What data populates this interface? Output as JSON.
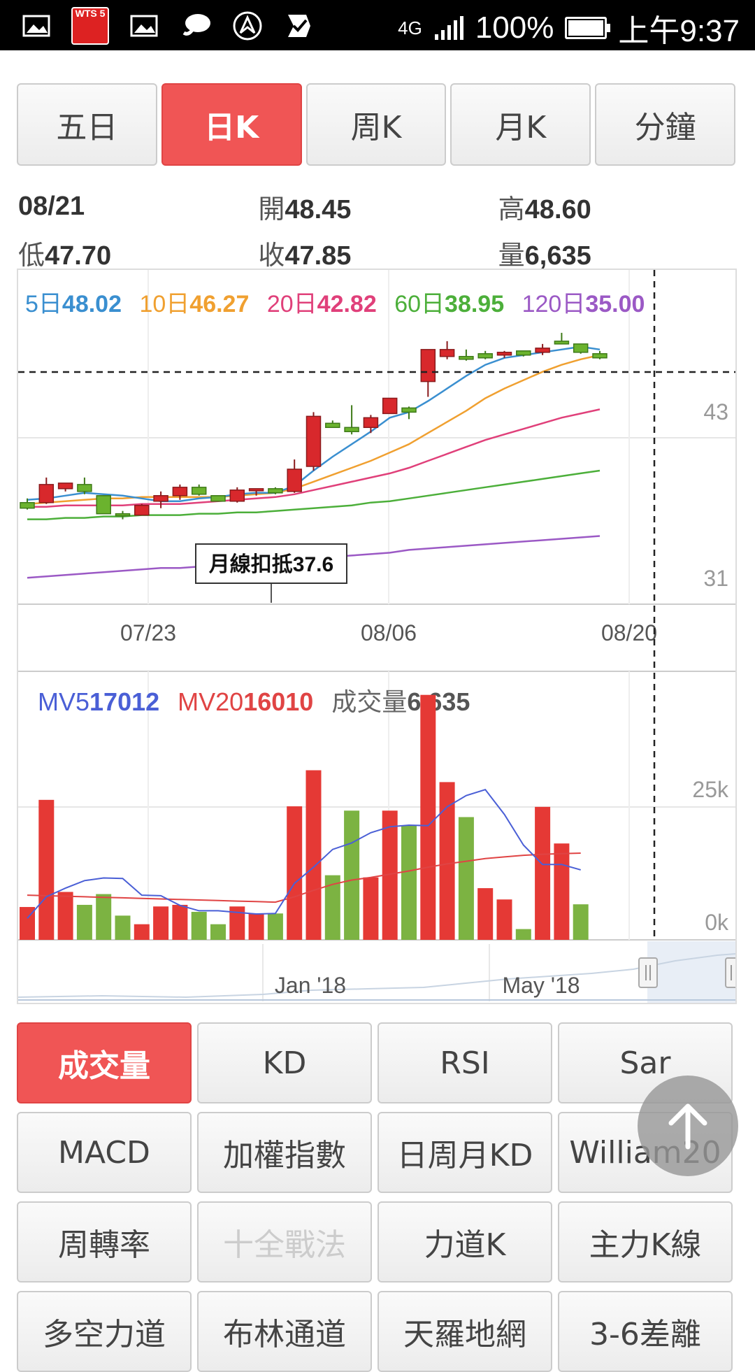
{
  "status_bar": {
    "icons": [
      "gallery-icon",
      "app-badge-icon",
      "gallery-icon",
      "chat-icon",
      "nav-icon",
      "check-icon"
    ],
    "badge_text": "WTS 5",
    "network": "4G",
    "battery": "100%",
    "time": "上午9:37"
  },
  "period_tabs": [
    {
      "label": "五日",
      "active": false
    },
    {
      "label": "日K",
      "active": true
    },
    {
      "label": "周K",
      "active": false
    },
    {
      "label": "月K",
      "active": false
    },
    {
      "label": "分鐘",
      "active": false
    }
  ],
  "quote": {
    "date": "08/21",
    "open_label": "開",
    "open": "48.45",
    "high_label": "高",
    "high": "48.60",
    "low_label": "低",
    "low": "47.70",
    "close_label": "收",
    "close": "47.85",
    "vol_label": "量",
    "vol": "6,635"
  },
  "ma_legend": [
    {
      "label": "5日",
      "value": "48.02",
      "color": "#3a8fd0"
    },
    {
      "label": "10日",
      "value": "46.27",
      "color": "#f0a030"
    },
    {
      "label": "20日",
      "value": "42.82",
      "color": "#e0407a"
    },
    {
      "label": "60日",
      "value": "38.95",
      "color": "#4caf3a"
    },
    {
      "label": "120日",
      "value": "35.00",
      "color": "#9b59c5"
    }
  ],
  "annotation": "月線扣抵37.6",
  "price_axis": {
    "labels": [
      "43",
      "31"
    ]
  },
  "x_dates": [
    "07/23",
    "08/06",
    "08/20"
  ],
  "vol_legend": {
    "mv5_label": "MV5",
    "mv5": "17012",
    "mv20_label": "MV20",
    "mv20": "16010",
    "vol_label": "成交量",
    "vol": "6,635"
  },
  "vol_axis": {
    "labels": [
      "25k",
      "0k"
    ]
  },
  "navigator": {
    "labels": [
      "Jan '18",
      "May '18"
    ]
  },
  "indicator_buttons": [
    {
      "label": "成交量",
      "active": true,
      "disabled": false
    },
    {
      "label": "KD",
      "active": false,
      "disabled": false
    },
    {
      "label": "RSI",
      "active": false,
      "disabled": false
    },
    {
      "label": "Sar",
      "active": false,
      "disabled": false
    },
    {
      "label": "MACD",
      "active": false,
      "disabled": false
    },
    {
      "label": "加權指數",
      "active": false,
      "disabled": false
    },
    {
      "label": "日周月KD",
      "active": false,
      "disabled": false
    },
    {
      "label": "William20",
      "active": false,
      "disabled": false
    },
    {
      "label": "周轉率",
      "active": false,
      "disabled": false
    },
    {
      "label": "十全戰法",
      "active": false,
      "disabled": true
    },
    {
      "label": "力道K",
      "active": false,
      "disabled": false
    },
    {
      "label": "主力K線",
      "active": false,
      "disabled": false
    },
    {
      "label": "多空力道",
      "active": false,
      "disabled": false
    },
    {
      "label": "布林通道",
      "active": false,
      "disabled": false
    },
    {
      "label": "天羅地網",
      "active": false,
      "disabled": false
    },
    {
      "label": "3-6差離",
      "active": false,
      "disabled": false
    }
  ],
  "chart_data": [
    {
      "type": "candlestick",
      "ylim": [
        29.5,
        49.5
      ],
      "candles": [
        {
          "o": 36.8,
          "h": 37.1,
          "l": 36.3,
          "c": 36.4
        },
        {
          "o": 36.8,
          "h": 38.6,
          "l": 36.7,
          "c": 38.1
        },
        {
          "o": 37.8,
          "h": 38.2,
          "l": 37.6,
          "c": 38.2
        },
        {
          "o": 38.1,
          "h": 38.6,
          "l": 37.4,
          "c": 37.6
        },
        {
          "o": 37.3,
          "h": 37.3,
          "l": 36.0,
          "c": 36.0
        },
        {
          "o": 36.0,
          "h": 36.2,
          "l": 35.6,
          "c": 35.9
        },
        {
          "o": 35.9,
          "h": 36.7,
          "l": 35.9,
          "c": 36.6
        },
        {
          "o": 36.9,
          "h": 37.6,
          "l": 36.4,
          "c": 37.3
        },
        {
          "o": 37.3,
          "h": 38.1,
          "l": 37.0,
          "c": 37.9
        },
        {
          "o": 37.9,
          "h": 38.1,
          "l": 37.3,
          "c": 37.4
        },
        {
          "o": 37.3,
          "h": 37.3,
          "l": 36.9,
          "c": 36.9
        },
        {
          "o": 36.9,
          "h": 37.9,
          "l": 36.8,
          "c": 37.7
        },
        {
          "o": 37.7,
          "h": 37.8,
          "l": 37.3,
          "c": 37.8
        },
        {
          "o": 37.8,
          "h": 37.9,
          "l": 37.4,
          "c": 37.5
        },
        {
          "o": 37.6,
          "h": 39.9,
          "l": 37.5,
          "c": 39.2
        },
        {
          "o": 39.4,
          "h": 43.3,
          "l": 39.1,
          "c": 43.0
        },
        {
          "o": 42.5,
          "h": 42.7,
          "l": 42.2,
          "c": 42.2
        },
        {
          "o": 42.2,
          "h": 43.8,
          "l": 41.7,
          "c": 41.9
        },
        {
          "o": 42.2,
          "h": 43.1,
          "l": 41.8,
          "c": 42.9
        },
        {
          "o": 43.2,
          "h": 44.3,
          "l": 43.2,
          "c": 44.3
        },
        {
          "o": 43.6,
          "h": 43.7,
          "l": 42.8,
          "c": 43.3
        },
        {
          "o": 45.5,
          "h": 47.8,
          "l": 44.4,
          "c": 47.8
        },
        {
          "o": 47.3,
          "h": 48.4,
          "l": 47.1,
          "c": 47.8
        },
        {
          "o": 47.3,
          "h": 47.8,
          "l": 47.0,
          "c": 47.1
        },
        {
          "o": 47.5,
          "h": 47.7,
          "l": 47.1,
          "c": 47.2
        },
        {
          "o": 47.4,
          "h": 47.7,
          "l": 47.2,
          "c": 47.6
        },
        {
          "o": 47.7,
          "h": 47.7,
          "l": 47.3,
          "c": 47.4
        },
        {
          "o": 47.6,
          "h": 48.2,
          "l": 47.4,
          "c": 47.9
        },
        {
          "o": 48.4,
          "h": 49.0,
          "l": 48.2,
          "c": 48.2
        },
        {
          "o": 48.2,
          "h": 48.2,
          "l": 47.5,
          "c": 47.6
        },
        {
          "o": 47.5,
          "h": 47.7,
          "l": 47.1,
          "c": 47.2
        }
      ],
      "ma5": [
        37.0,
        37.1,
        37.3,
        37.5,
        37.4,
        37.3,
        37.1,
        36.9,
        36.9,
        37.1,
        37.2,
        37.4,
        37.5,
        37.5,
        38.0,
        39.1,
        40.1,
        41.0,
        41.9,
        42.9,
        43.3,
        44.1,
        45.0,
        45.9,
        46.7,
        47.2,
        47.4,
        47.6,
        47.8,
        48.0,
        47.8
      ],
      "ma10": [
        36.7,
        36.8,
        36.9,
        37.0,
        37.1,
        37.1,
        37.2,
        37.2,
        37.2,
        37.2,
        37.2,
        37.3,
        37.4,
        37.5,
        37.8,
        38.3,
        38.8,
        39.3,
        39.8,
        40.4,
        41.0,
        41.8,
        42.6,
        43.4,
        44.3,
        45.0,
        45.6,
        46.2,
        46.7,
        47.1,
        47.4
      ],
      "ma20": [
        36.5,
        36.5,
        36.6,
        36.6,
        36.6,
        36.6,
        36.7,
        36.7,
        36.7,
        36.8,
        36.9,
        37.0,
        37.1,
        37.2,
        37.4,
        37.7,
        38.0,
        38.3,
        38.6,
        38.9,
        39.3,
        39.8,
        40.3,
        40.8,
        41.3,
        41.7,
        42.1,
        42.5,
        42.9,
        43.2,
        43.5
      ],
      "ma60": [
        35.6,
        35.6,
        35.7,
        35.7,
        35.8,
        35.8,
        35.9,
        35.9,
        35.9,
        36.0,
        36.0,
        36.1,
        36.1,
        36.2,
        36.3,
        36.4,
        36.5,
        36.6,
        36.8,
        36.9,
        37.1,
        37.3,
        37.5,
        37.7,
        37.9,
        38.1,
        38.3,
        38.5,
        38.7,
        38.9,
        39.1
      ],
      "ma120": [
        31.4,
        31.5,
        31.6,
        31.7,
        31.8,
        31.9,
        32.0,
        32.1,
        32.1,
        32.2,
        32.3,
        32.4,
        32.5,
        32.6,
        32.7,
        32.8,
        32.9,
        33.0,
        33.1,
        33.2,
        33.4,
        33.5,
        33.6,
        33.7,
        33.8,
        33.9,
        34.0,
        34.1,
        34.2,
        34.3,
        34.4
      ]
    },
    {
      "type": "bar",
      "ylim": [
        0,
        46500
      ],
      "volumes": [
        6100,
        26000,
        8900,
        6500,
        8500,
        4500,
        2900,
        6200,
        6500,
        5200,
        2900,
        6200,
        4900,
        4900,
        24800,
        31500,
        12000,
        24000,
        11600,
        24000,
        21200,
        45500,
        29300,
        22800,
        9600,
        7500,
        2000,
        24700,
        17900,
        6600
      ],
      "up": [
        true,
        true,
        true,
        false,
        false,
        false,
        true,
        true,
        true,
        false,
        false,
        true,
        true,
        false,
        true,
        true,
        false,
        false,
        true,
        true,
        false,
        true,
        true,
        false,
        true,
        true,
        false,
        true,
        true,
        false
      ],
      "mv5": [
        4000,
        8000,
        9600,
        11000,
        11500,
        11400,
        8300,
        8200,
        6400,
        5400,
        5400,
        5100,
        4800,
        4900,
        10500,
        13500,
        16800,
        18000,
        19900,
        21000,
        21300,
        21200,
        24700,
        26800,
        27900,
        23300,
        17600,
        14000,
        14000,
        13000
      ],
      "mv20": [
        8300,
        8200,
        8100,
        8000,
        7900,
        7800,
        7700,
        7600,
        7500,
        7400,
        7300,
        7200,
        7100,
        7000,
        8000,
        9200,
        10300,
        11100,
        11600,
        12200,
        12800,
        13500,
        14100,
        14600,
        15100,
        15400,
        15700,
        15900,
        16000,
        16100
      ]
    }
  ]
}
